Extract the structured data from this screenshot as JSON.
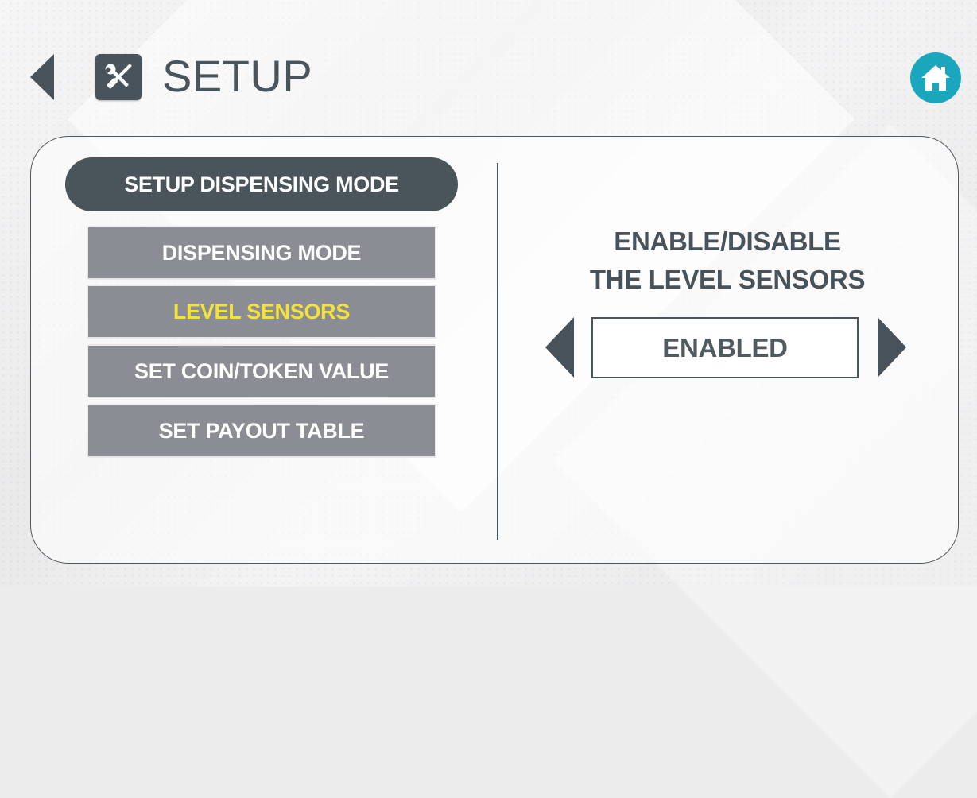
{
  "header": {
    "title": "SETUP",
    "back_icon": "back-arrow-icon",
    "setup_icon": "wrench-screwdriver-icon",
    "home_icon": "home-icon"
  },
  "menu": {
    "section_title": "SETUP DISPENSING MODE",
    "items": [
      {
        "label": "DISPENSING MODE",
        "selected": false
      },
      {
        "label": "LEVEL SENSORS",
        "selected": true
      },
      {
        "label": "SET COIN/TOKEN VALUE",
        "selected": false
      },
      {
        "label": "SET PAYOUT TABLE",
        "selected": false
      }
    ]
  },
  "option": {
    "title_line1": "ENABLE/DISABLE",
    "title_line2": "THE LEVEL SENSORS",
    "value": "ENABLED"
  },
  "colors": {
    "primary_dark": "#4a545b",
    "menu_item_bg": "#8a8d94",
    "selected_text": "#f4e13a",
    "home_button": "#1aa6bd"
  }
}
